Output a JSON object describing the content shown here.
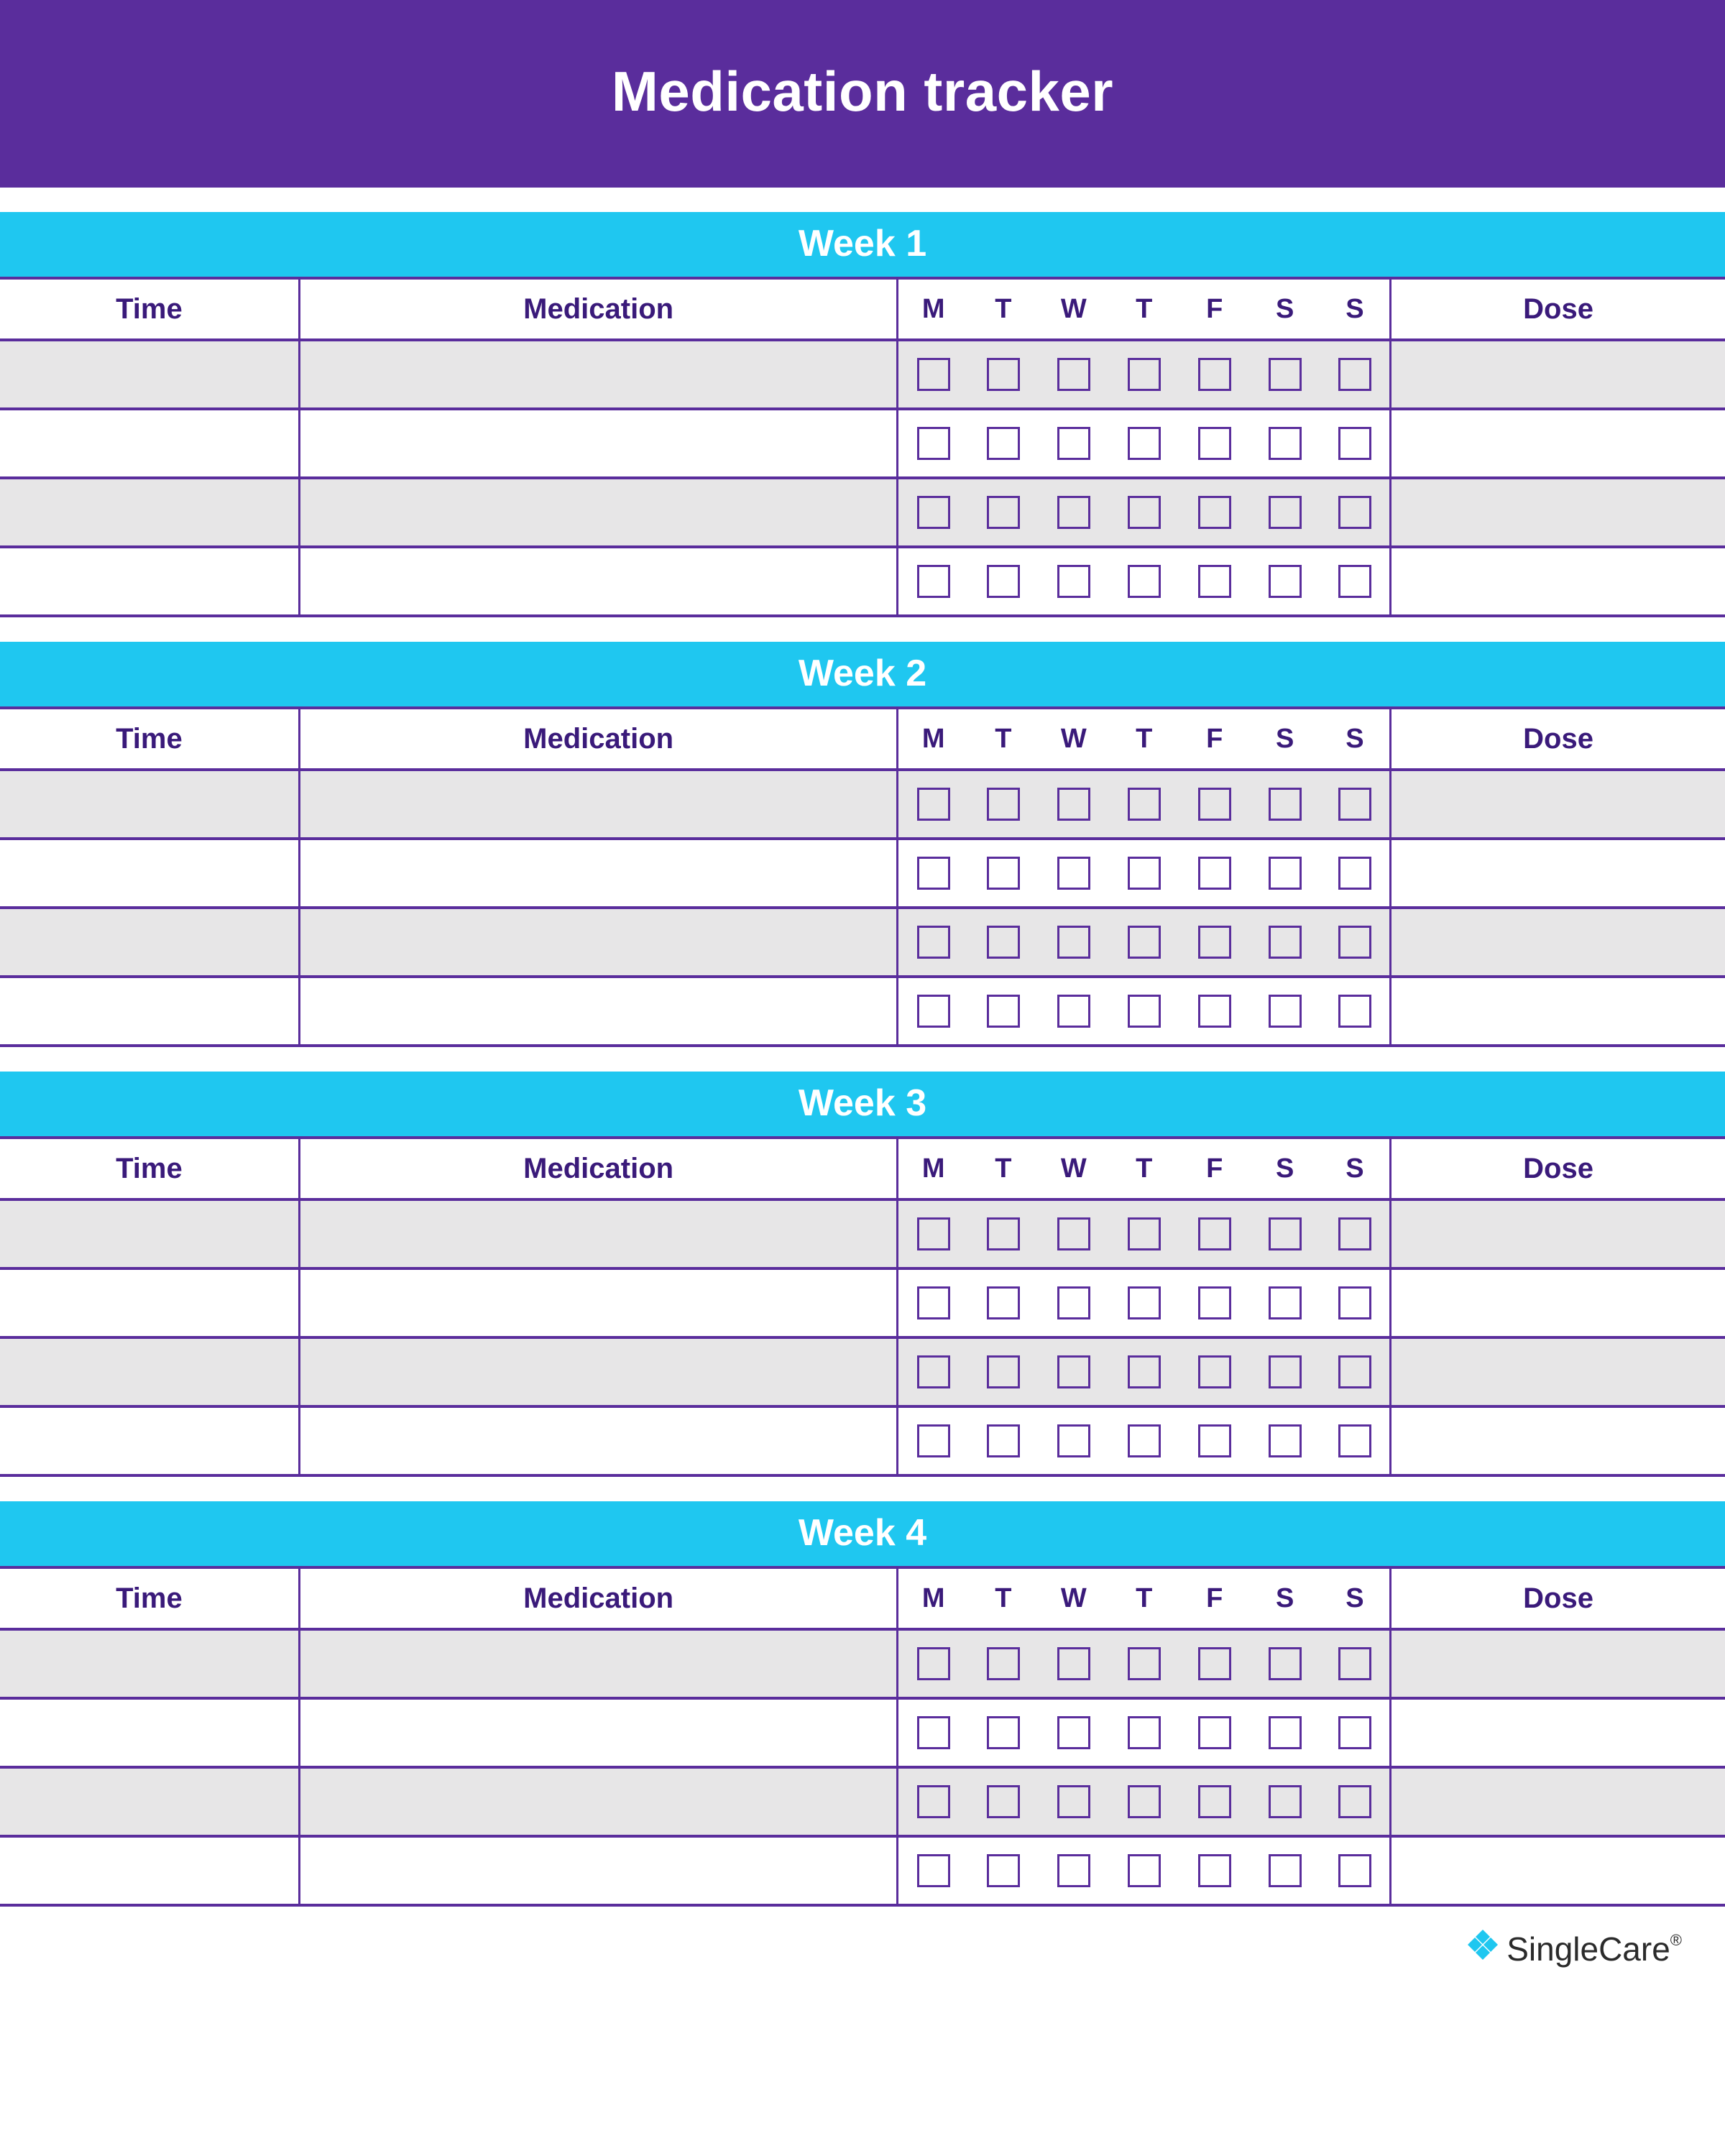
{
  "title": "Medication tracker",
  "columns": {
    "time": "Time",
    "medication": "Medication",
    "dose": "Dose"
  },
  "days": [
    "M",
    "T",
    "W",
    "T",
    "F",
    "S",
    "S"
  ],
  "weeks": [
    {
      "label": "Week 1",
      "rows": [
        {
          "time": "",
          "medication": "",
          "checks": [
            false,
            false,
            false,
            false,
            false,
            false,
            false
          ],
          "dose": ""
        },
        {
          "time": "",
          "medication": "",
          "checks": [
            false,
            false,
            false,
            false,
            false,
            false,
            false
          ],
          "dose": ""
        },
        {
          "time": "",
          "medication": "",
          "checks": [
            false,
            false,
            false,
            false,
            false,
            false,
            false
          ],
          "dose": ""
        },
        {
          "time": "",
          "medication": "",
          "checks": [
            false,
            false,
            false,
            false,
            false,
            false,
            false
          ],
          "dose": ""
        }
      ]
    },
    {
      "label": "Week 2",
      "rows": [
        {
          "time": "",
          "medication": "",
          "checks": [
            false,
            false,
            false,
            false,
            false,
            false,
            false
          ],
          "dose": ""
        },
        {
          "time": "",
          "medication": "",
          "checks": [
            false,
            false,
            false,
            false,
            false,
            false,
            false
          ],
          "dose": ""
        },
        {
          "time": "",
          "medication": "",
          "checks": [
            false,
            false,
            false,
            false,
            false,
            false,
            false
          ],
          "dose": ""
        },
        {
          "time": "",
          "medication": "",
          "checks": [
            false,
            false,
            false,
            false,
            false,
            false,
            false
          ],
          "dose": ""
        }
      ]
    },
    {
      "label": "Week 3",
      "rows": [
        {
          "time": "",
          "medication": "",
          "checks": [
            false,
            false,
            false,
            false,
            false,
            false,
            false
          ],
          "dose": ""
        },
        {
          "time": "",
          "medication": "",
          "checks": [
            false,
            false,
            false,
            false,
            false,
            false,
            false
          ],
          "dose": ""
        },
        {
          "time": "",
          "medication": "",
          "checks": [
            false,
            false,
            false,
            false,
            false,
            false,
            false
          ],
          "dose": ""
        },
        {
          "time": "",
          "medication": "",
          "checks": [
            false,
            false,
            false,
            false,
            false,
            false,
            false
          ],
          "dose": ""
        }
      ]
    },
    {
      "label": "Week 4",
      "rows": [
        {
          "time": "",
          "medication": "",
          "checks": [
            false,
            false,
            false,
            false,
            false,
            false,
            false
          ],
          "dose": ""
        },
        {
          "time": "",
          "medication": "",
          "checks": [
            false,
            false,
            false,
            false,
            false,
            false,
            false
          ],
          "dose": ""
        },
        {
          "time": "",
          "medication": "",
          "checks": [
            false,
            false,
            false,
            false,
            false,
            false,
            false
          ],
          "dose": ""
        },
        {
          "time": "",
          "medication": "",
          "checks": [
            false,
            false,
            false,
            false,
            false,
            false,
            false
          ],
          "dose": ""
        }
      ]
    }
  ],
  "footer": {
    "brand": "SingleCare",
    "tm": "®"
  }
}
